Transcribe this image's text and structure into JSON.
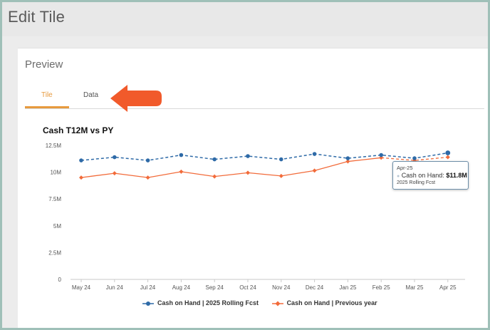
{
  "header": {
    "title": "Edit Tile"
  },
  "preview": {
    "label": "Preview",
    "tabs": [
      {
        "label": "Tile",
        "active": true
      },
      {
        "label": "Data",
        "active": false
      }
    ],
    "arrow_color": "#f15a2b"
  },
  "tooltip": {
    "date": "Apr-25",
    "metric": "Cash on Hand",
    "value": "$11.8M",
    "series": "2025 Rolling Fcst"
  },
  "chart_data": {
    "type": "line",
    "title": "Cash T12M vs PY",
    "categories": [
      "May 24",
      "Jun 24",
      "Jul 24",
      "Aug 24",
      "Sep 24",
      "Oct 24",
      "Nov 24",
      "Dec 24",
      "Jan 25",
      "Feb 25",
      "Mar 25",
      "Apr 25"
    ],
    "yticks": [
      "0",
      "2.5M",
      "5M",
      "7.5M",
      "10M",
      "12.5M"
    ],
    "ylim": [
      0,
      12.5
    ],
    "grid": false,
    "legend": "bottom",
    "series": [
      {
        "name": "Cash on Hand | 2025 Rolling Fcst",
        "color": "#2e6aa7",
        "marker": "circle",
        "style": "dashed",
        "values": [
          11.1,
          11.4,
          11.1,
          11.6,
          11.2,
          11.5,
          11.2,
          11.7,
          11.3,
          11.6,
          11.3,
          11.8
        ]
      },
      {
        "name": "Cash on Hand | Previous year",
        "color": "#f26b3a",
        "marker": "diamond",
        "style": "dashed-solid",
        "values": [
          9.5,
          9.9,
          9.5,
          10.05,
          9.6,
          9.95,
          9.65,
          10.15,
          11.0,
          11.35,
          11.1,
          11.4
        ]
      }
    ]
  }
}
